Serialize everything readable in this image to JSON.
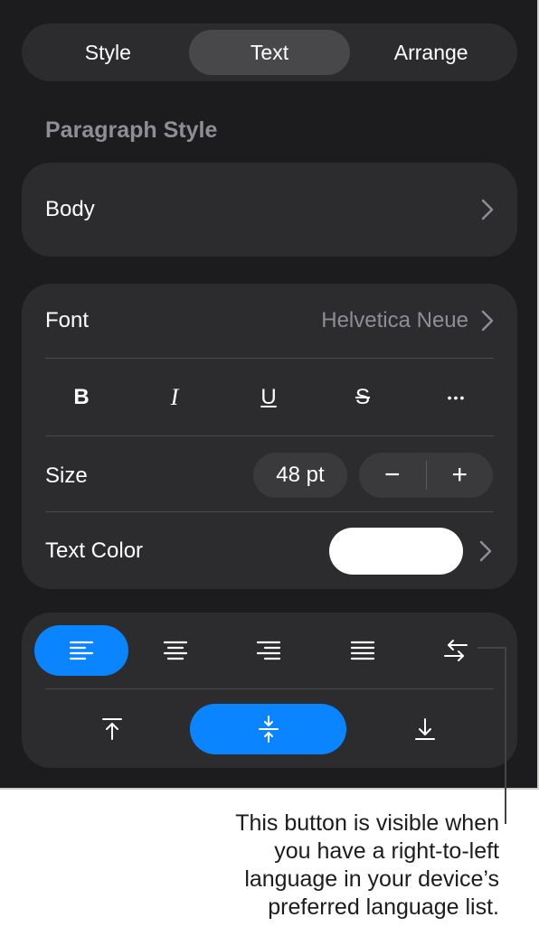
{
  "tabs": [
    {
      "label": "Style",
      "active": false
    },
    {
      "label": "Text",
      "active": true
    },
    {
      "label": "Arrange",
      "active": false
    }
  ],
  "paragraph": {
    "section_label": "Paragraph Style",
    "value": "Body"
  },
  "font": {
    "label": "Font",
    "value": "Helvetica Neue"
  },
  "format_buttons": {
    "bold": "B",
    "italic": "I",
    "underline": "U",
    "strikethrough": "S",
    "more": "•••"
  },
  "size": {
    "label": "Size",
    "value": "48 pt",
    "decrease": "−",
    "increase": "+"
  },
  "text_color": {
    "label": "Text Color",
    "swatch_color": "#ffffff"
  },
  "alignment": {
    "selected_horizontal": "left",
    "selected_vertical": "middle"
  },
  "colors": {
    "accent": "#0a84ff",
    "panel_bg": "#1c1c1e",
    "card_bg": "#2c2c2e"
  },
  "caption": "This button is visible when\nyou have a right-to-left\nlanguage in your device’s\npreferred language list."
}
